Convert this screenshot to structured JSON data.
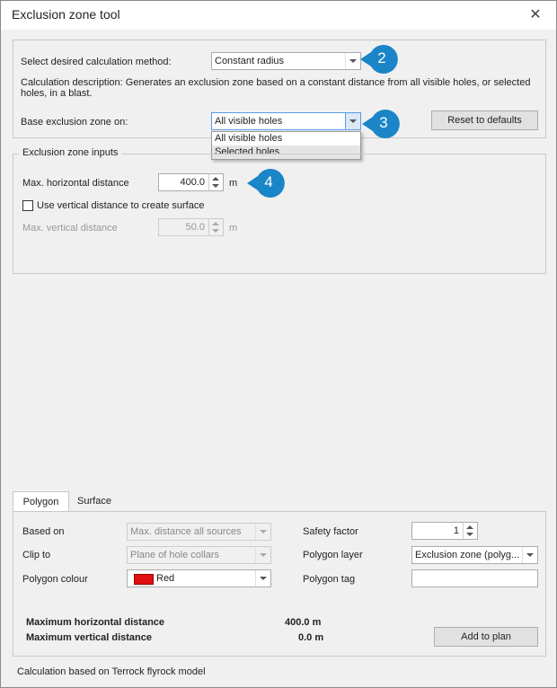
{
  "window": {
    "title": "Exclusion zone tool",
    "close_icon": "close-icon"
  },
  "method": {
    "label": "Select desired calculation method:",
    "value": "Constant radius",
    "description": "Calculation description: Generates an exclusion zone based on a constant distance from all visible holes, or selected holes, in a blast."
  },
  "base": {
    "label": "Base exclusion zone on:",
    "value": "All visible holes",
    "options": [
      "All visible holes",
      "Selected holes"
    ]
  },
  "reset_button": "Reset to defaults",
  "inputs_group": {
    "caption": "Exclusion zone inputs",
    "max_horizontal": {
      "label": "Max. horizontal distance",
      "value": "400.0",
      "unit": "m"
    },
    "use_vertical": {
      "label": "Use vertical distance to create surface",
      "checked": false
    },
    "max_vertical": {
      "label": "Max. vertical distance",
      "value": "50.0",
      "unit": "m"
    }
  },
  "callouts": [
    "2",
    "3",
    "4"
  ],
  "tabs": [
    "Polygon",
    "Surface"
  ],
  "polygon": {
    "based_on": {
      "label": "Based on",
      "value": "Max. distance all sources"
    },
    "clip_to": {
      "label": "Clip to",
      "value": "Plane of hole collars"
    },
    "colour": {
      "label": "Polygon colour",
      "value": "Red",
      "color": "#e01010"
    },
    "safety_factor": {
      "label": "Safety factor",
      "value": "1"
    },
    "layer": {
      "label": "Polygon layer",
      "value": "Exclusion zone (polyg..."
    },
    "tag": {
      "label": "Polygon tag",
      "value": ""
    }
  },
  "results": {
    "max_horizontal": {
      "label": "Maximum horizontal distance",
      "value": "400.0 m"
    },
    "max_vertical": {
      "label": "Maximum vertical distance",
      "value": "0.0 m"
    }
  },
  "add_to_plan_button": "Add to plan",
  "footer": "Calculation based on Terrock flyrock model",
  "colors": {
    "callout": "#1a85c7",
    "accent": "#569de5"
  }
}
